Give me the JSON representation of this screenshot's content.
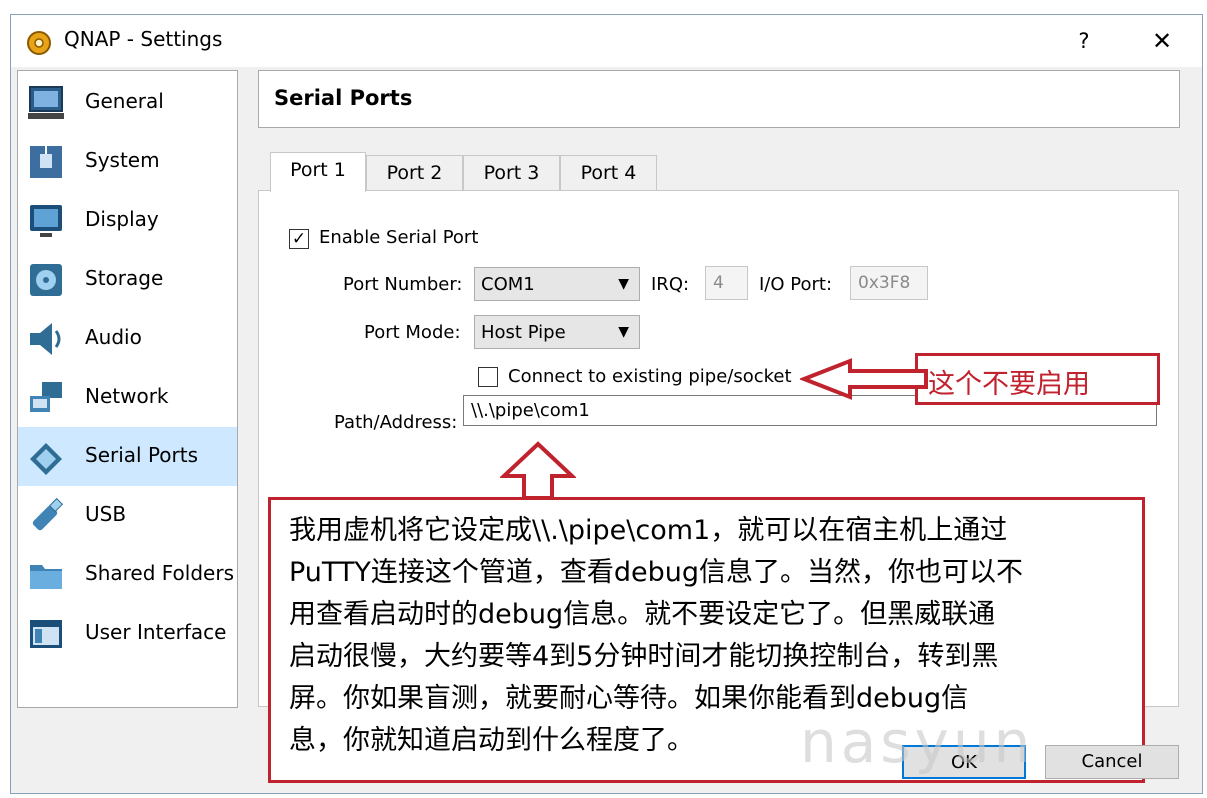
{
  "window": {
    "title": "QNAP - Settings",
    "help_glyph": "?",
    "close_glyph": "✕"
  },
  "sidebar": {
    "items": [
      {
        "label": "General",
        "icon": "general-icon"
      },
      {
        "label": "System",
        "icon": "system-icon"
      },
      {
        "label": "Display",
        "icon": "display-icon"
      },
      {
        "label": "Storage",
        "icon": "storage-icon"
      },
      {
        "label": "Audio",
        "icon": "audio-icon"
      },
      {
        "label": "Network",
        "icon": "network-icon"
      },
      {
        "label": "Serial Ports",
        "icon": "serial-ports-icon",
        "selected": true
      },
      {
        "label": "USB",
        "icon": "usb-icon"
      },
      {
        "label": "Shared Folders",
        "icon": "shared-folders-icon"
      },
      {
        "label": "User Interface",
        "icon": "user-interface-icon"
      }
    ]
  },
  "header": {
    "title": "Serial Ports"
  },
  "tabs": [
    {
      "label": "Port 1",
      "active": true
    },
    {
      "label": "Port 2"
    },
    {
      "label": "Port 3"
    },
    {
      "label": "Port 4"
    }
  ],
  "port": {
    "enable_label": "Enable Serial Port",
    "enable_checked": true,
    "port_number_label": "Port Number:",
    "port_number_value": "COM1",
    "irq_label": "IRQ:",
    "irq_value": "4",
    "io_port_label": "I/O Port:",
    "io_port_value": "0x3F8",
    "port_mode_label": "Port Mode:",
    "port_mode_value": "Host Pipe",
    "connect_existing_label": "Connect to existing pipe/socket",
    "connect_existing_checked": false,
    "path_label": "Path/Address:",
    "path_value": "\\\\.\\pipe\\com1"
  },
  "annotations": {
    "short": "这个不要启用",
    "long_lines": [
      "我用虚机将它设定成\\\\.\\pipe\\com1，就可以在宿主机上通过",
      "PuTTY连接这个管道，查看debug信息了。当然，你也可以不",
      "用查看启动时的debug信息。就不要设定它了。但黑威联通",
      "启动很慢，大约要等4到5分钟时间才能切换控制台，转到黑",
      "屏。你如果盲测，就要耐心等待。如果你能看到debug信",
      "息，你就知道启动到什么程度了。"
    ],
    "color": "#c0222e"
  },
  "buttons": {
    "ok": "OK",
    "cancel": "Cancel"
  },
  "watermark": "nasyun"
}
